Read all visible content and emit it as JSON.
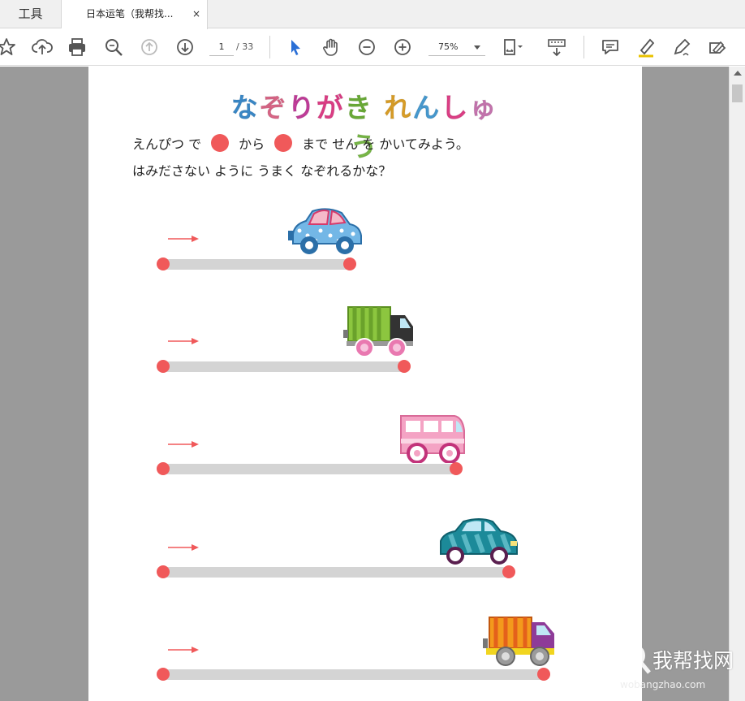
{
  "tabs": {
    "tools_label": "工具",
    "document_label": "日本运笔（我帮找...",
    "close_symbol": "×"
  },
  "toolbar": {
    "page_current": "1",
    "page_total": "/ 33",
    "zoom_value": "75%",
    "icons": [
      "bookmark-star-icon",
      "upload-cloud-icon",
      "print-icon",
      "zoom-search-icon",
      "previous-page-icon",
      "next-page-icon",
      "select-cursor-icon",
      "hand-tool-icon",
      "zoom-out-icon",
      "zoom-in-icon",
      "fit-page-icon",
      "keyboard-scroll-icon",
      "comment-icon",
      "highlight-pen-icon",
      "sign-pen-icon",
      "fill-sign-icon"
    ]
  },
  "page": {
    "title": "なぞりがき れんしゅう",
    "title_colors": [
      "#3d8fd1",
      "#e26b8d",
      "#c93fa0",
      "#e6418b",
      "#6fb33a",
      "#e3a52a",
      "#4aa0d8",
      "#e6418b",
      "#cf7ab7",
      "#7dbf4a",
      "#e3a52a"
    ],
    "instruction_line1_a": "えんぴつ で",
    "instruction_line1_b": "から",
    "instruction_line1_c": "まで せん を かいてみよう。",
    "instruction_line2": "はみださない ように うまく なぞれるかな？",
    "accent_color": "#f0595a",
    "rows": [
      {
        "vehicle": "blue-polka-dot-car",
        "track_fraction": 0.33
      },
      {
        "vehicle": "green-truck",
        "track_fraction": 0.43
      },
      {
        "vehicle": "pink-bus",
        "track_fraction": 0.53
      },
      {
        "vehicle": "teal-car",
        "track_fraction": 0.62
      },
      {
        "vehicle": "orange-dump-truck",
        "track_fraction": 0.69
      }
    ]
  },
  "watermark": {
    "title": "我帮找网",
    "url": "wobangzhao.com"
  }
}
